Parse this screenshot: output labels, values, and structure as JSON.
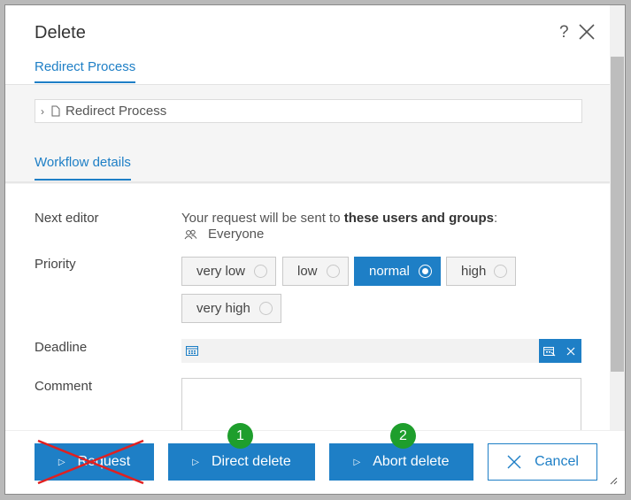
{
  "dialog": {
    "title": "Delete",
    "help": "?"
  },
  "tabs": {
    "process": "Redirect Process",
    "workflow": "Workflow details"
  },
  "object_field": {
    "chevron": "›",
    "value": "Redirect Process"
  },
  "next_editor": {
    "label": "Next editor",
    "text_prefix": "Your request will be sent to ",
    "text_bold": "these users and groups",
    "text_suffix": ":",
    "group": "Everyone"
  },
  "priority": {
    "label": "Priority",
    "options": [
      "very low",
      "low",
      "normal",
      "high",
      "very high"
    ],
    "selected": "normal"
  },
  "deadline": {
    "label": "Deadline",
    "value": ""
  },
  "comment": {
    "label": "Comment",
    "value": ""
  },
  "buttons": {
    "request": "Request",
    "direct_delete": "Direct delete",
    "abort_delete": "Abort delete",
    "cancel": "Cancel"
  },
  "badges": {
    "direct_delete": "1",
    "abort_delete": "2"
  },
  "icons": [
    "help-icon",
    "close-icon",
    "document-icon",
    "users-icon",
    "calendar-icon",
    "calendar-pick-icon",
    "clear-icon",
    "play-icon",
    "cancel-x-icon",
    "resize-grip-icon"
  ],
  "colors": {
    "accent": "#1e7fc6",
    "badge": "#1e9e2c",
    "strike": "#e02020"
  }
}
